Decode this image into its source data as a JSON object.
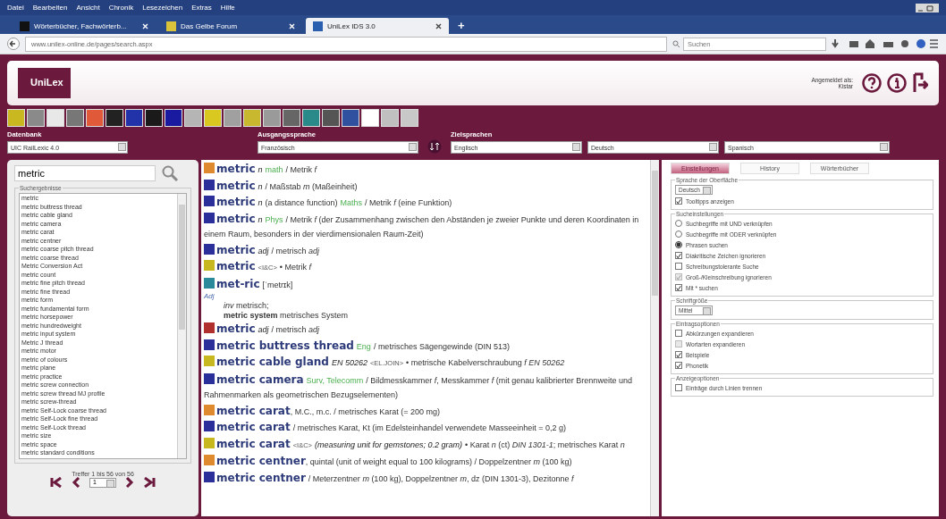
{
  "browser": {
    "menu": [
      "Datei",
      "Bearbeiten",
      "Ansicht",
      "Chronik",
      "Lesezeichen",
      "Extras",
      "Hilfe"
    ],
    "tabs": [
      {
        "label": "Wörterbücher, Fachwörterb...",
        "selected": false,
        "color": "#111111"
      },
      {
        "label": "Das Gelbe Forum",
        "selected": false,
        "color": "#d9c33a"
      },
      {
        "label": "UniLex IDS 3.0",
        "selected": true,
        "color": "#2a5fb0"
      }
    ],
    "new_tab": "+",
    "address": "www.unilex-online.de/pages/search.aspx",
    "search_placeholder": "Suchen"
  },
  "header": {
    "logo": "UniLex",
    "login_label": "Angemeldet als:",
    "user": "Kistar"
  },
  "dictionaries": [
    {
      "color": "#c9b820"
    },
    {
      "color": "#8a8a8a"
    },
    {
      "color": "#e8e8e8"
    },
    {
      "color": "#777777"
    },
    {
      "color": "#e05a3a"
    },
    {
      "color": "#222222"
    },
    {
      "color": "#2233aa"
    },
    {
      "color": "#1a1a1a"
    },
    {
      "color": "#1a1aa0"
    },
    {
      "color": "#b5b5b5"
    },
    {
      "color": "#d8c820"
    },
    {
      "color": "#a0a0a0"
    },
    {
      "color": "#c8b830"
    },
    {
      "color": "#9a9a9a"
    },
    {
      "color": "#666666"
    },
    {
      "color": "#2a8a8a"
    },
    {
      "color": "#555555"
    },
    {
      "color": "#3050a0"
    },
    {
      "color": "#ffffff"
    },
    {
      "color": "#c0c0c0"
    },
    {
      "color": "#c8c8c8"
    }
  ],
  "datenbank": {
    "label": "Datenbank",
    "value": "UIC RailLexic 4.0"
  },
  "ausgangssprache": {
    "label": "Ausgangssprache",
    "value": "Französisch"
  },
  "zielsprachen": {
    "label": "Zielsprachen",
    "values": [
      "Englisch",
      "Deutsch",
      "Spanisch"
    ]
  },
  "search": {
    "value": "metric"
  },
  "results": {
    "legend": "Suchergebnisse",
    "items": [
      "metric",
      "metric buttress thread",
      "metric cable gland",
      "metric camera",
      "metric carat",
      "metric centner",
      "metric coarse pitch thread",
      "metric coarse thread",
      "Metric Conversion Act",
      "metric count",
      "metric fine pitch thread",
      "metric fine thread",
      "metric form",
      "metric fundamental form",
      "metric horsepower",
      "metric hundredweight",
      "metric input system",
      "Metric J thread",
      "metric motor",
      "metric of colours",
      "metric plane",
      "metric practice",
      "metric screw connection",
      "metric screw thread MJ profile",
      "metric screw-thread",
      "metric Self-Lock coarse thread",
      "metric Self-Lock fine thread",
      "metric Self-Lock thread",
      "metric size",
      "metric space",
      "metric standard conditions"
    ],
    "hits": "Treffer 1 bis 56 von 56",
    "page": "1"
  },
  "entries": [
    {
      "color": "#e08a30",
      "head": "metric",
      "parts": [
        {
          "kind": "gram",
          "text": "n"
        },
        {
          "kind": "domain",
          "text": "math"
        },
        {
          "kind": "plain",
          "text": "/ Metrik *f*"
        }
      ]
    },
    {
      "color": "#2b2f9a",
      "head": "metric",
      "parts": [
        {
          "kind": "gram",
          "text": "n"
        },
        {
          "kind": "plain",
          "text": "/ Maßstab *m* (Maßeinheit)"
        }
      ]
    },
    {
      "color": "#2b2f9a",
      "head": "metric",
      "parts": [
        {
          "kind": "gram",
          "text": "n"
        },
        {
          "kind": "plain",
          "text": "(a distance function)"
        },
        {
          "kind": "domain",
          "text": "Maths"
        },
        {
          "kind": "plain",
          "text": "/ Metrik *f* (eine Funktion)"
        }
      ]
    },
    {
      "color": "#2b2f9a",
      "head": "metric",
      "parts": [
        {
          "kind": "gram",
          "text": "n"
        },
        {
          "kind": "domain",
          "text": "Phys"
        },
        {
          "kind": "plain",
          "text": "/ Metrik *f* (der Zusammenhang zwischen den Abständen je zweier Punkte und deren Koordinaten in einem Raum, besonders in der vierdimensionalen Raum-Zeit)"
        }
      ]
    },
    {
      "color": "#2b2f9a",
      "head": "metric",
      "parts": [
        {
          "kind": "gram",
          "text": "adj"
        },
        {
          "kind": "plain",
          "text": "/ metrisch *adj*"
        }
      ]
    },
    {
      "color": "#c8b820",
      "head": "metric",
      "parts": [
        {
          "kind": "tag",
          "text": "<I&C>"
        },
        {
          "kind": "plain",
          "text": "• Metrik *f*"
        }
      ]
    },
    {
      "color": "#2a8a9a",
      "head": "met-ric",
      "parts": [
        {
          "kind": "plain",
          "text": "[ˈmetrɪk]"
        }
      ],
      "sub": [
        {
          "kind": "pos",
          "text": "Adj"
        },
        {
          "kind": "indent",
          "text": "*inv* metrisch;"
        },
        {
          "kind": "example",
          "text": "**metric system** metrisches System"
        }
      ]
    },
    {
      "color": "#b03030",
      "head": "metric",
      "parts": [
        {
          "kind": "gram",
          "text": "adj"
        },
        {
          "kind": "plain",
          "text": "/ metrisch *adj*"
        }
      ]
    },
    {
      "color": "#2b2f9a",
      "head": "metric buttress thread",
      "parts": [
        {
          "kind": "domain",
          "text": "Eng"
        },
        {
          "kind": "plain",
          "text": "/ metrisches Sägengewinde (DIN 513)"
        }
      ]
    },
    {
      "color": "#c8b820",
      "head": "metric cable gland",
      "parts": [
        {
          "kind": "gram",
          "text": "EN 50262"
        },
        {
          "kind": "tag",
          "text": "<EL.JOIN>"
        },
        {
          "kind": "plain",
          "text": "• metrische Kabelverschraubung *f EN 50262*"
        }
      ]
    },
    {
      "color": "#2b2f9a",
      "head": "metric camera",
      "parts": [
        {
          "kind": "domain",
          "text": "Surv, Telecomm"
        },
        {
          "kind": "plain",
          "text": "/ Bildmesskammer *f*, Messkammer *f* (mit genau kalibrierter Brennweite und Rahmenmarken als geometrischen Bezugselementen)"
        }
      ]
    },
    {
      "color": "#e08a30",
      "head": "metric carat",
      "parts": [
        {
          "kind": "plain",
          "text": ", M.C., m.c. / metrisches Karat (= 200 mg)"
        }
      ]
    },
    {
      "color": "#2b2f9a",
      "head": "metric carat",
      "parts": [
        {
          "kind": "plain",
          "text": "/ metrisches Karat, Kt (im Edelsteinhandel verwendete Masseeinheit = 0,2 g)"
        }
      ]
    },
    {
      "color": "#c8b820",
      "head": "metric carat",
      "parts": [
        {
          "kind": "tag",
          "text": "<I&C>"
        },
        {
          "kind": "gram",
          "text": "(measuring unit for gemstones; 0.2 gram)"
        },
        {
          "kind": "plain",
          "text": "• Karat *n* (ct) *DIN 1301-1*; metrisches Karat *n*"
        }
      ]
    },
    {
      "color": "#e08a30",
      "head": "metric centner",
      "parts": [
        {
          "kind": "plain",
          "text": ", quintal (unit of weight equal to 100 kilograms) / Doppelzentner *m* (100 kg)"
        }
      ]
    },
    {
      "color": "#2b2f9a",
      "head": "metric centner",
      "parts": [
        {
          "kind": "plain",
          "text": "/ Meterzentner *m* (100 kg), Doppelzentner *m*, dz (DIN 1301-3), Dezitonne *f*"
        }
      ]
    }
  ],
  "settings": {
    "tabs": [
      {
        "label": "Einstellungen",
        "selected": true
      },
      {
        "label": "History",
        "selected": false
      },
      {
        "label": "Wörterbücher",
        "selected": false
      }
    ],
    "groups": [
      {
        "legend": "Sprache der Oberfläche",
        "items": [
          {
            "kind": "select",
            "label": "Deutsch"
          },
          {
            "kind": "checkbox",
            "label": "Tooltipps anzeigen",
            "checked": true,
            "disabled": false
          }
        ]
      },
      {
        "legend": "Sucheinstellungen",
        "items": [
          {
            "kind": "radio",
            "label": "Suchbegriffe mit UND verknüpfen",
            "selected": false
          },
          {
            "kind": "radio",
            "label": "Suchbegriffe mit ODER verknüpfen",
            "selected": false
          },
          {
            "kind": "radio",
            "label": "Phrasen suchen",
            "selected": true
          },
          {
            "kind": "checkbox",
            "label": "Diakritische Zeichen ignorieren",
            "checked": true,
            "disabled": false
          },
          {
            "kind": "checkbox",
            "label": "Schreibungstolerante Suche",
            "checked": false,
            "disabled": false
          },
          {
            "kind": "checkbox",
            "label": "Groß-/Kleinschreibung ignorieren",
            "checked": true,
            "disabled": true
          },
          {
            "kind": "checkbox",
            "label": "Mit * suchen",
            "checked": true,
            "disabled": false
          }
        ]
      },
      {
        "legend": "Schriftgröße",
        "items": [
          {
            "kind": "select",
            "label": "Mittel"
          }
        ]
      },
      {
        "legend": "Eintragsoptionen",
        "items": [
          {
            "kind": "checkbox",
            "label": "Abkürzungen expandieren",
            "checked": false,
            "disabled": false
          },
          {
            "kind": "checkbox",
            "label": "Wortarten expandieren",
            "checked": false,
            "disabled": true
          },
          {
            "kind": "checkbox",
            "label": "Beispiele",
            "checked": true,
            "disabled": false
          },
          {
            "kind": "checkbox",
            "label": "Phonetik",
            "checked": true,
            "disabled": false
          }
        ]
      },
      {
        "legend": "Anzeigeoptionen",
        "items": [
          {
            "kind": "checkbox",
            "label": "Einträge durch Linien trennen",
            "checked": false,
            "disabled": false
          }
        ]
      }
    ]
  }
}
